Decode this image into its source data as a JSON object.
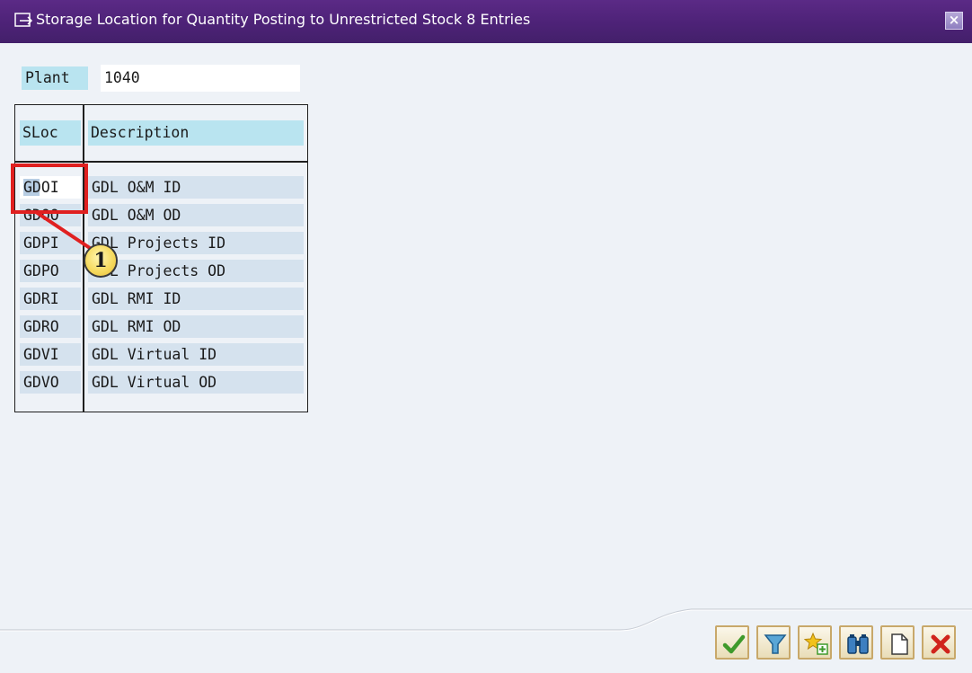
{
  "window": {
    "title": "Storage Location for Quantity Posting to Unrestricted Stock 8 Entries",
    "close_glyph": "×",
    "title_icon": "dialog-icon"
  },
  "plant": {
    "label": "Plant",
    "value": "1040"
  },
  "table": {
    "headers": {
      "sloc": "SLoc",
      "description": "Description"
    },
    "rows": [
      {
        "sloc": "GDOI",
        "description": "GDL O&M ID"
      },
      {
        "sloc": "GDOO",
        "description": "GDL O&M OD"
      },
      {
        "sloc": "GDPI",
        "description": "GDL Projects ID"
      },
      {
        "sloc": "GDPO",
        "description": "GDL Projects OD"
      },
      {
        "sloc": "GDRI",
        "description": "GDL RMI ID"
      },
      {
        "sloc": "GDRO",
        "description": "GDL RMI OD"
      },
      {
        "sloc": "GDVI",
        "description": "GDL Virtual ID"
      },
      {
        "sloc": "GDVO",
        "description": "GDL Virtual OD"
      }
    ],
    "selected_row": 0
  },
  "annotation": {
    "callout_number": "1",
    "color": "#e02020"
  },
  "toolbar": {
    "buttons": [
      "checkmark-icon",
      "filter-icon",
      "new-favorite-icon",
      "binoculars-icon",
      "new-document-icon",
      "cancel-icon"
    ]
  },
  "colors": {
    "titlebar": "#4d2277",
    "field_label_bg": "#b9e4f0",
    "row_bg": "#d5e2ee",
    "body_bg": "#eef2f7"
  }
}
